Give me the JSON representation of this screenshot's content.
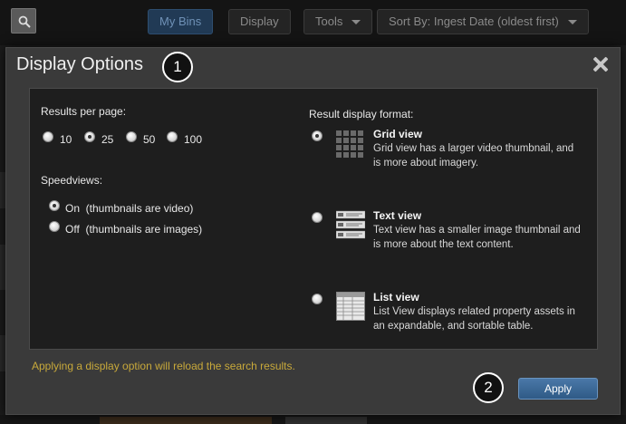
{
  "toolbar": {
    "my_bins_label": "My Bins",
    "display_label": "Display",
    "tools_label": "Tools",
    "sort_label": "Sort By: Ingest Date (oldest first)",
    "search_icon": "search-icon"
  },
  "modal": {
    "title": "Display Options",
    "close_icon": "close-icon",
    "callouts": [
      "1",
      "2"
    ],
    "results_per_page": {
      "label": "Results per page:",
      "options": [
        "10",
        "25",
        "50",
        "100"
      ],
      "selected": "25"
    },
    "speedviews": {
      "label": "Speedviews:",
      "options": [
        "On  (thumbnails are video)",
        "Off  (thumbnails are images)"
      ],
      "selected": "On"
    },
    "result_format": {
      "label": "Result display format:",
      "selected": "Grid view",
      "options": [
        {
          "title": "Grid view",
          "desc": "Grid view has a larger video thumbnail, and is more about imagery.",
          "icon": "grid-view-icon"
        },
        {
          "title": "Text view",
          "desc": "Text view has a smaller image thumbnail and is more about the text content.",
          "icon": "text-view-icon"
        },
        {
          "title": "List view",
          "desc": "List View displays related property assets in an expandable, and sortable table.",
          "icon": "list-view-icon"
        }
      ]
    },
    "note": "Applying a display option will reload the search results.",
    "apply_label": "Apply"
  },
  "colors": {
    "modal_bg": "#3a3a3a",
    "panel_bg": "#1e1e1e",
    "note": "#c8a93a",
    "apply": "#3a6896"
  }
}
